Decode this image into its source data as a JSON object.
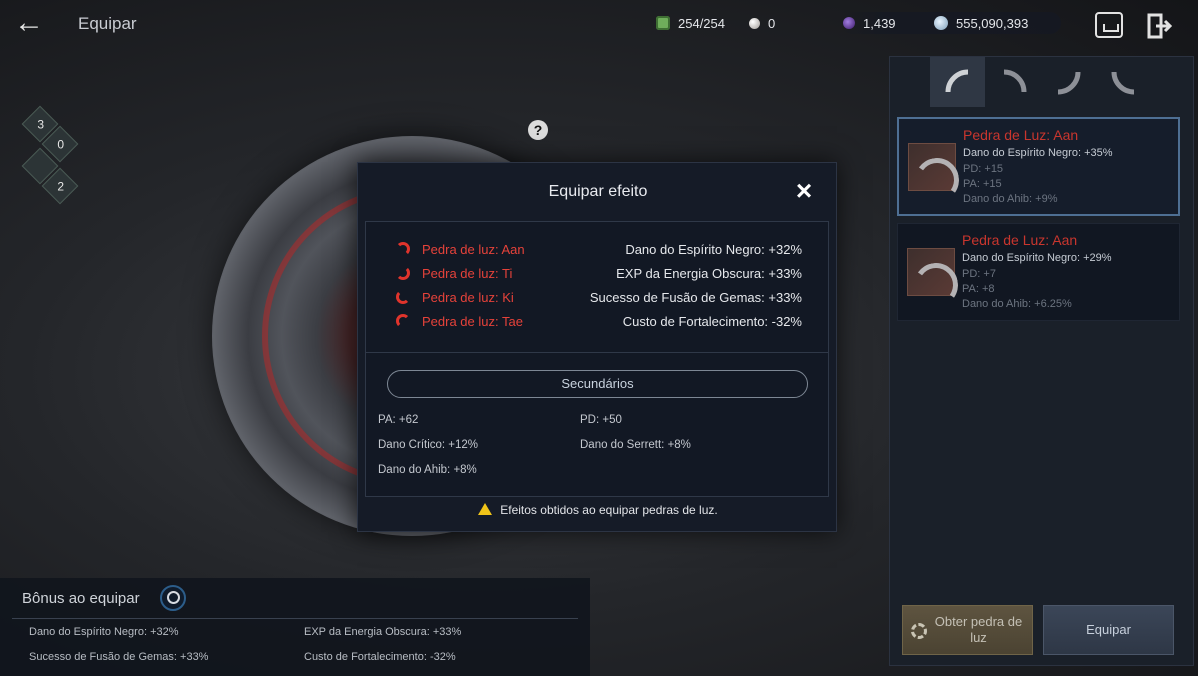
{
  "header": {
    "title": "Equipar",
    "resources": [
      {
        "icon": "energy-icon",
        "value": "254/254"
      },
      {
        "icon": "pearl-icon",
        "value": "0"
      },
      {
        "icon": "dark-orb-icon",
        "value": "1,439"
      },
      {
        "icon": "silver-icon",
        "value": "555,090,393"
      }
    ]
  },
  "side_icons": [
    "3",
    "0",
    "",
    "2"
  ],
  "dialog": {
    "title": "Equipar efeito",
    "effects": [
      {
        "name": "Pedra de luz: Aan",
        "value": "Dano do Espírito Negro: +32%"
      },
      {
        "name": "Pedra de luz: Ti",
        "value": "EXP da Energia Obscura: +33%"
      },
      {
        "name": "Pedra de luz: Ki",
        "value": "Sucesso de Fusão de Gemas: +33%"
      },
      {
        "name": "Pedra de luz: Tae",
        "value": "Custo de Fortalecimento: -32%"
      }
    ],
    "secondary_title": "Secundários",
    "secondary": [
      "PA: +62",
      "PD: +50",
      "Dano Crítico: +12%",
      "Dano do Serrett: +8%",
      "Dano do Ahib: +8%"
    ],
    "note": "Efeitos obtidos ao equipar pedras de luz."
  },
  "bonus": {
    "title": "Bônus ao equipar",
    "items": [
      "Dano do Espírito Negro: +32%",
      "EXP da Energia Obscura: +33%",
      "Sucesso de Fusão de Gemas: +33%",
      "Custo de Fortalecimento: -32%"
    ]
  },
  "stones": [
    {
      "name": "Pedra de Luz: Aan",
      "stats": [
        "Dano do Espírito Negro: +35%",
        "PD: +15",
        "PA: +15",
        "Dano do Ahib: +9%"
      ]
    },
    {
      "name": "Pedra de Luz: Aan",
      "stats": [
        "Dano do Espírito Negro: +29%",
        "PD: +7",
        "PA: +8",
        "Dano do Ahib: +6.25%"
      ]
    }
  ],
  "buttons": {
    "obtain": "Obter pedra de luz",
    "equip": "Equipar"
  },
  "colors": {
    "accent_red": "#e5423a",
    "selected_border": "#4e6f93",
    "warning": "#f0c419"
  }
}
